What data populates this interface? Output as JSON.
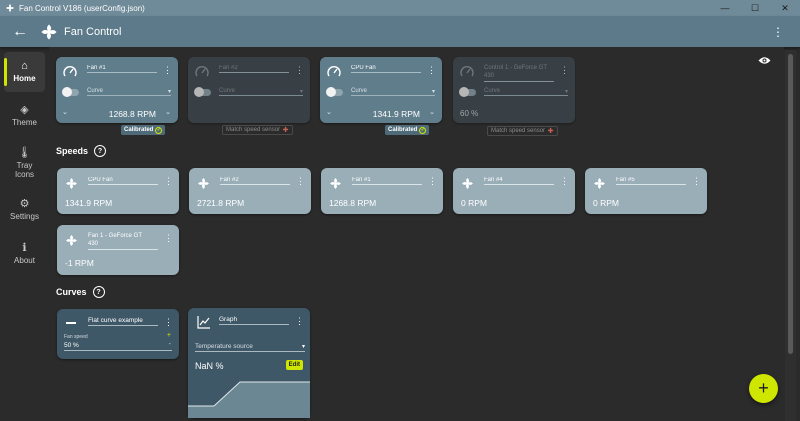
{
  "window": {
    "title": "Fan Control V186 (userConfig.json)",
    "minimize": "—",
    "maximize": "☐",
    "close": "✕"
  },
  "appbar": {
    "back_icon": "←",
    "title": "Fan Control",
    "menu_icon": "⋮"
  },
  "sidebar": {
    "items": [
      {
        "label": "Home",
        "icon": "home-icon",
        "glyph": "⌂",
        "active": true
      },
      {
        "label": "Theme",
        "icon": "paint-bucket-icon",
        "glyph": "◈",
        "active": false
      },
      {
        "label": "Tray\nIcons",
        "label_line1": "Tray",
        "label_line2": "Icons",
        "icon": "thermometer-icon",
        "glyph": "🌡",
        "active": false
      },
      {
        "label": "Settings",
        "icon": "gear-icon",
        "glyph": "⚙",
        "active": false
      },
      {
        "label": "About",
        "icon": "info-icon",
        "glyph": "ℹ",
        "active": false
      }
    ]
  },
  "visibility_icon": "eye-icon",
  "controls": [
    {
      "name": "Fan #1",
      "curve": "Curve",
      "rpm": "1268.8 RPM",
      "badge": "Calibrated",
      "badge_type": "ok",
      "enabled": true
    },
    {
      "name": "Fan #2",
      "curve": "Curve",
      "rpm": "",
      "badge": "Match speed sensor",
      "badge_type": "warn",
      "enabled": false
    },
    {
      "name": "CPU Fan",
      "curve": "Curve",
      "rpm": "1341.9 RPM",
      "badge": "Calibrated",
      "badge_type": "ok",
      "enabled": true
    },
    {
      "name": "Control 1 - GeForce GT 430",
      "curve": "Curve",
      "pct": "60 %",
      "rpm": "",
      "badge": "Match speed sensor",
      "badge_type": "warn",
      "enabled": false
    }
  ],
  "speeds": {
    "label": "Speeds",
    "items": [
      {
        "name": "CPU Fan",
        "rpm": "1341.9 RPM"
      },
      {
        "name": "Fan #2",
        "rpm": "2721.8 RPM"
      },
      {
        "name": "Fan #1",
        "rpm": "1268.8 RPM"
      },
      {
        "name": "Fan #4",
        "rpm": "0 RPM"
      },
      {
        "name": "Fan #5",
        "rpm": "0 RPM"
      },
      {
        "name": "Fan 1 - GeForce GT 430",
        "name_line1": "Fan 1 - GeForce GT",
        "name_line2": "430",
        "rpm": "-1 RPM"
      }
    ]
  },
  "curves": {
    "label": "Curves",
    "flat": {
      "name": "Flat curve example",
      "field_label": "Fan speed",
      "value": "50 %"
    },
    "graph": {
      "name": "Graph",
      "source_placeholder": "Temperature source",
      "value": "NaN %",
      "edit_label": "Edit"
    }
  },
  "fab_label": "+",
  "help_glyph": "?",
  "colors": {
    "accent": "#cfe600",
    "card": "#607d8c",
    "speed_card": "#9aaeb8",
    "curve_card": "#3f5868",
    "appbar": "#5c7a8a"
  }
}
